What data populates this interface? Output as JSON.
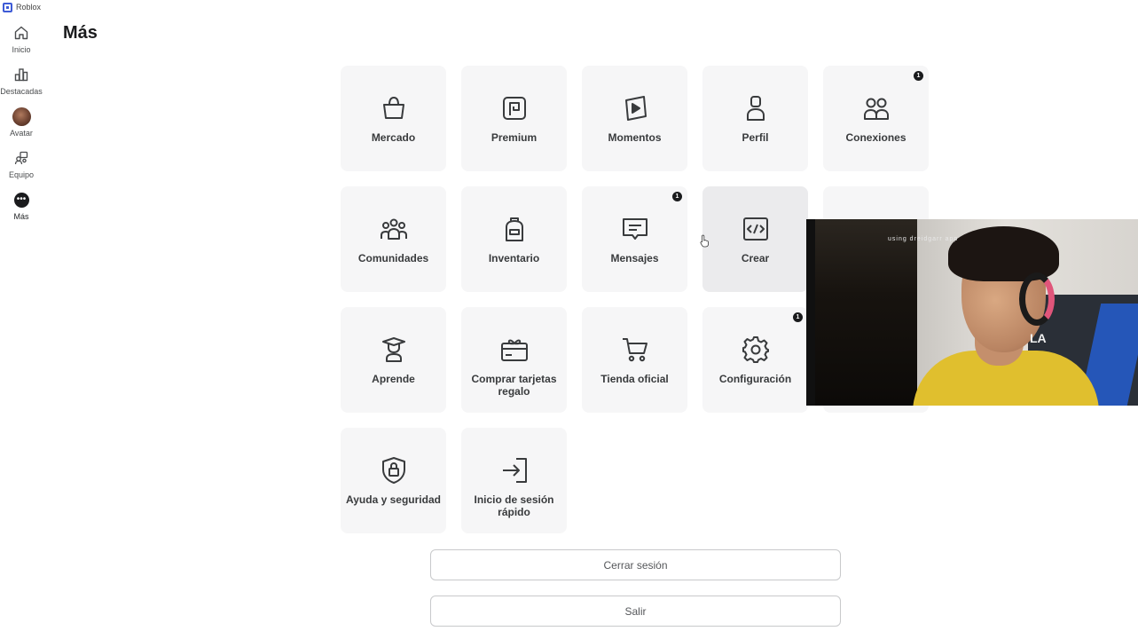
{
  "app": {
    "title": "Roblox"
  },
  "sidebar": {
    "items": [
      {
        "label": "Inicio",
        "icon": "home-icon"
      },
      {
        "label": "Destacadas",
        "icon": "charts-icon"
      },
      {
        "label": "Avatar",
        "icon": "avatar-icon"
      },
      {
        "label": "Equipo",
        "icon": "party-icon"
      },
      {
        "label": "Más",
        "icon": "more-icon"
      }
    ],
    "more_glyph": "•••"
  },
  "page": {
    "title": "Más"
  },
  "tiles": [
    {
      "label": "Mercado",
      "icon": "marketplace-bag-icon"
    },
    {
      "label": "Premium",
      "icon": "premium-icon"
    },
    {
      "label": "Momentos",
      "icon": "moments-play-icon"
    },
    {
      "label": "Perfil",
      "icon": "profile-icon"
    },
    {
      "label": "Conexiones",
      "icon": "connections-icon",
      "badge": "1"
    },
    {
      "label": "Comunidades",
      "icon": "communities-icon"
    },
    {
      "label": "Inventario",
      "icon": "inventory-backpack-icon"
    },
    {
      "label": "Mensajes",
      "icon": "messages-icon",
      "badge": "1"
    },
    {
      "label": "Crear",
      "icon": "create-code-icon"
    },
    {
      "label": "",
      "icon": "hidden-tile-icon"
    },
    {
      "label": "Aprende",
      "icon": "learn-icon"
    },
    {
      "label": "Comprar tarjetas regalo",
      "icon": "gift-card-icon"
    },
    {
      "label": "Tienda oficial",
      "icon": "shopping-cart-icon"
    },
    {
      "label": "Configuración",
      "icon": "settings-gear-icon",
      "badge": "1"
    },
    {
      "label": "",
      "icon": "hidden-tile-icon"
    },
    {
      "label": "Ayuda y seguridad",
      "icon": "help-safety-lock-icon"
    },
    {
      "label": "Inicio de sesión rápido",
      "icon": "quick-login-icon"
    }
  ],
  "buttons": {
    "logout": "Cerrar sesión",
    "exit": "Salir"
  },
  "webcam": {
    "overlay_text": "using dreidgarr app",
    "shirt_mark": "LA"
  },
  "colors": {
    "accent": "#3e5bd6",
    "tile_bg": "#f6f6f7",
    "badge": "#1a1b1d"
  }
}
